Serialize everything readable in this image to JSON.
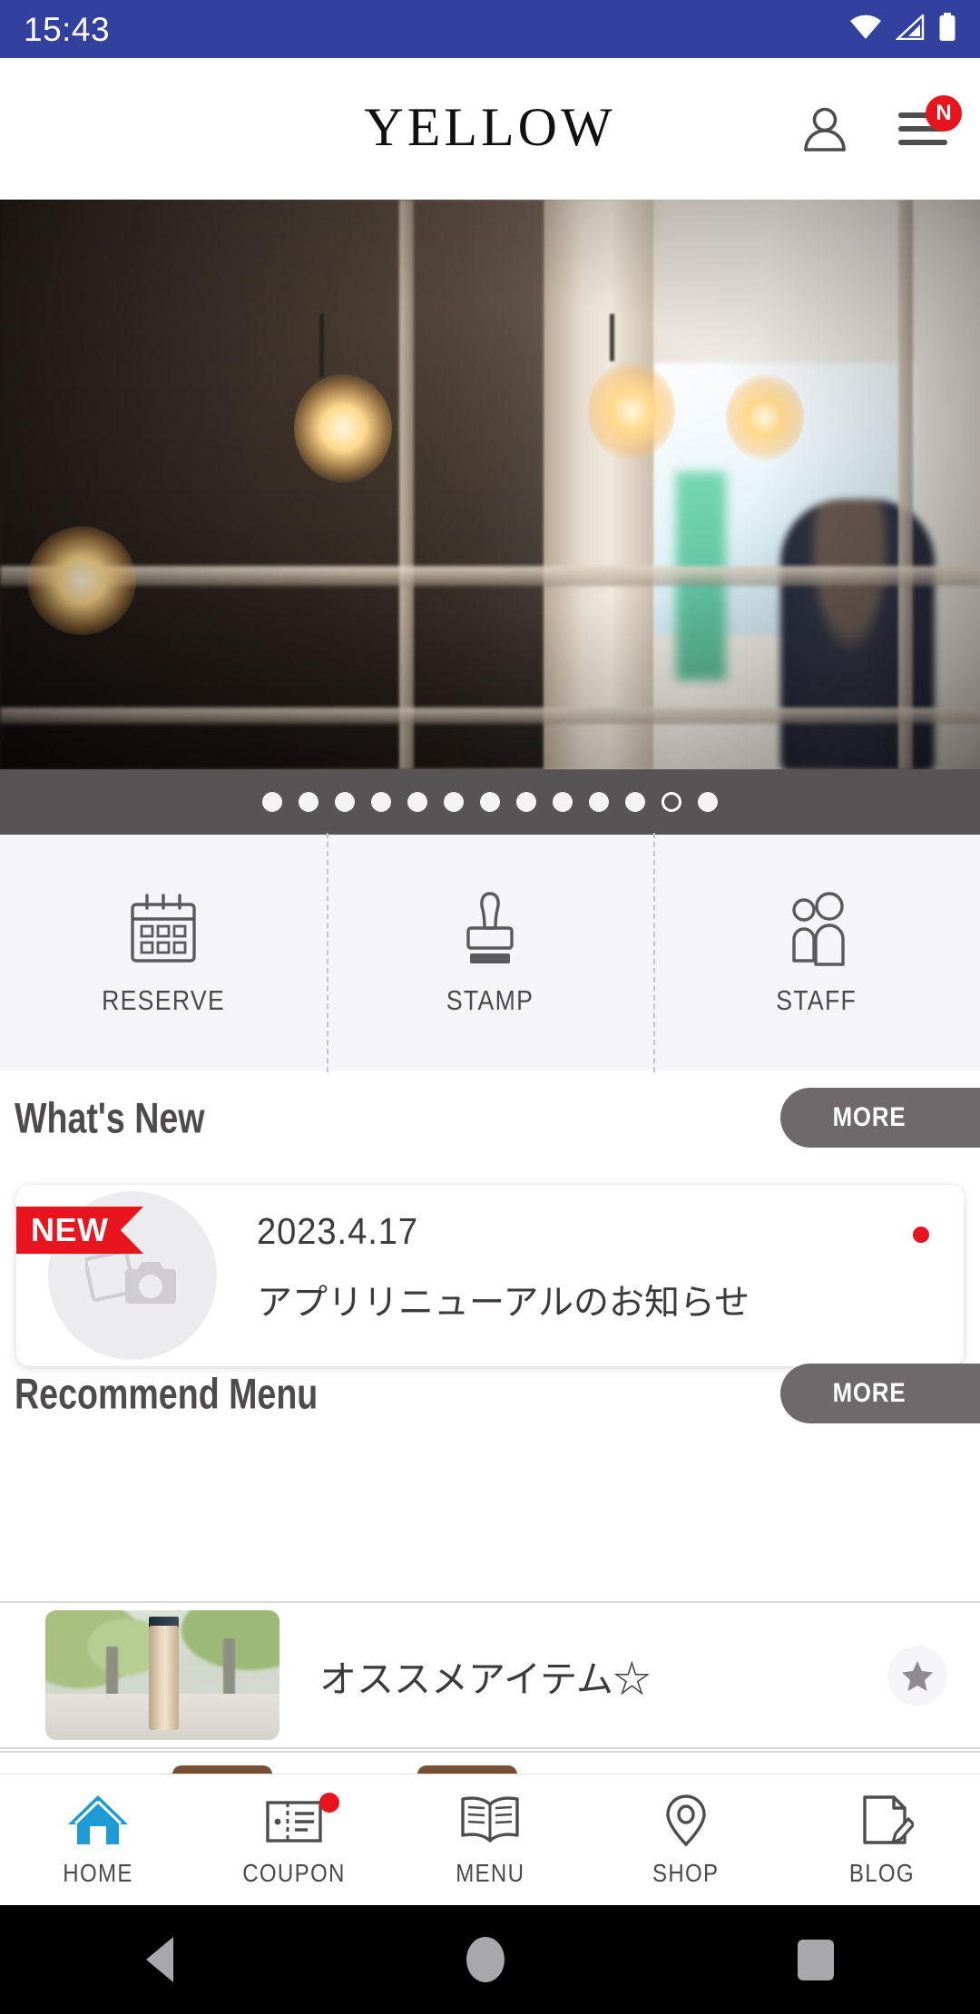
{
  "status_bar": {
    "time": "15:43",
    "background_color": "#32409E",
    "icons": [
      "wifi-icon",
      "cellular-signal-icon",
      "battery-icon"
    ]
  },
  "header": {
    "brand": "YELLOW",
    "account_icon": "person-icon",
    "menu_icon": "hamburger-menu-icon",
    "menu_badge": "N",
    "badge_color": "#E8141E"
  },
  "hero": {
    "carousel_total_dots": 13,
    "active_dot_index": 11,
    "strip_color": "#575456"
  },
  "quick_actions": [
    {
      "label": "RESERVE",
      "icon": "calendar-icon"
    },
    {
      "label": "STAMP",
      "icon": "stamp-icon"
    },
    {
      "label": "STAFF",
      "icon": "people-icon"
    }
  ],
  "whats_new": {
    "title": "What's New",
    "more_label": "MORE",
    "items": [
      {
        "badge": "NEW",
        "date": "2023.4.17",
        "title": "アプリリニューアルのお知らせ",
        "thumb_icon": "image-placeholder-icon",
        "unread": true
      }
    ]
  },
  "recommend_menu": {
    "title": "Recommend Menu",
    "more_label": "MORE",
    "items": [
      {
        "title": "オススメアイテム☆",
        "favorite_icon": "star-icon"
      }
    ]
  },
  "bottom_nav": {
    "active_color": "#1E9BD7",
    "items": [
      {
        "label": "HOME",
        "icon": "home-icon",
        "active": true,
        "badge": false
      },
      {
        "label": "COUPON",
        "icon": "coupon-icon",
        "active": false,
        "badge": true
      },
      {
        "label": "MENU",
        "icon": "book-icon",
        "active": false,
        "badge": false
      },
      {
        "label": "SHOP",
        "icon": "location-pin-icon",
        "active": false,
        "badge": false
      },
      {
        "label": "BLOG",
        "icon": "document-pen-icon",
        "active": false,
        "badge": false
      }
    ]
  },
  "system_nav": {
    "back": "back-triangle-icon",
    "home": "home-circle-icon",
    "recents": "recents-square-icon"
  }
}
